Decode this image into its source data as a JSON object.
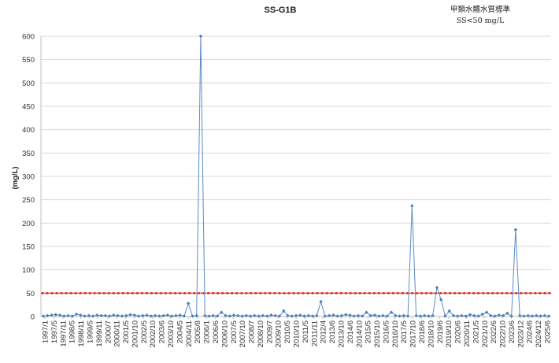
{
  "chart_data": {
    "type": "line",
    "title": "SS-G1B",
    "subtitle_line1": "甲類水體水質標準",
    "subtitle_line2": "SS<50 mg/L",
    "ylabel": "(mg/L)",
    "xlabel": "",
    "ylim": [
      0,
      600
    ],
    "yticks": [
      0,
      50,
      100,
      150,
      200,
      250,
      300,
      350,
      400,
      450,
      500,
      550,
      600
    ],
    "grid": true,
    "legend": "none",
    "x_tick_labels": [
      "1997/1",
      "1997/5",
      "1997/11",
      "1998/5",
      "1998/11",
      "1999/5",
      "1999/11",
      "2000/7",
      "2000/11",
      "2001/5",
      "2001/10",
      "2002/5",
      "2002/10",
      "2003/6",
      "2003/10",
      "2004/5",
      "2004/11",
      "2005/8",
      "2006/1",
      "2006/6",
      "2006/10",
      "2007/5",
      "2007/10",
      "2008/7",
      "2008/10",
      "2009/7",
      "2009/10",
      "2010/5",
      "2010/10",
      "2011/5",
      "2011/11",
      "2012/4",
      "2013/6",
      "2013/10",
      "2014/6",
      "2014/10",
      "2015/5",
      "2015/10",
      "2016/5",
      "2016/10",
      "2017/5",
      "2017/10",
      "2018/6",
      "2018/10",
      "2019/6",
      "2019/10",
      "2020/6",
      "2020/11",
      "2021/5",
      "2021/10",
      "2022/6",
      "2022/10",
      "2023/6",
      "2023/12",
      "2024/6",
      "2024/12",
      "2025/6"
    ],
    "standard": {
      "value": 50,
      "color": "#e0302a"
    },
    "series": [
      {
        "color": "#5b8cc8",
        "values": [
          1,
          2,
          3,
          4,
          3,
          1,
          2,
          1,
          5,
          3,
          1,
          2,
          1,
          3,
          2,
          2,
          1,
          3,
          2,
          1,
          2,
          4,
          3,
          1,
          2,
          3,
          1,
          2,
          1,
          2,
          3,
          1,
          2,
          3,
          1,
          28,
          1,
          2,
          600,
          2,
          1,
          2,
          1,
          9,
          2,
          1,
          3,
          2,
          1,
          2,
          1,
          2,
          1,
          2,
          1,
          3,
          2,
          1,
          12,
          2,
          1,
          2,
          3,
          1,
          2,
          1,
          2,
          32,
          1,
          2,
          3,
          1,
          2,
          4,
          3,
          1,
          2,
          1,
          9,
          2,
          3,
          1,
          2,
          1,
          9,
          2,
          1,
          2,
          1,
          237,
          2,
          1,
          2,
          1,
          2,
          62,
          36,
          1,
          12,
          2,
          1,
          2,
          1,
          4,
          2,
          1,
          5,
          9,
          2,
          1,
          3,
          2,
          7,
          1,
          186,
          2,
          1,
          2,
          1,
          2,
          1,
          2,
          1
        ]
      }
    ],
    "colors": {
      "axis": "#bfbfbf",
      "grid": "#d9d9d9",
      "marker": "#4a7ebb"
    }
  }
}
